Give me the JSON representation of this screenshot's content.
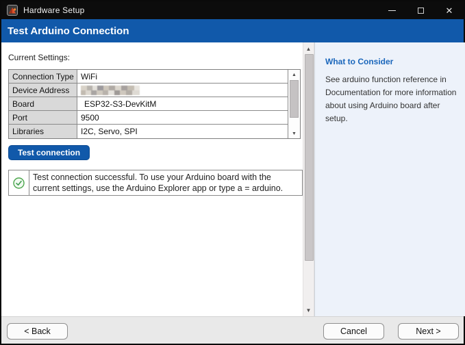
{
  "window": {
    "title": "Hardware Setup",
    "icons": {
      "app": "matlab-logo",
      "minimize": "minimize-line",
      "maximize": "maximize-square",
      "close": "✕"
    }
  },
  "header": {
    "title": "Test Arduino Connection",
    "background_color": "#1159aa"
  },
  "main": {
    "current_settings_label": "Current Settings:",
    "settings_table": {
      "rows": [
        {
          "label": "Connection Type",
          "value": "WiFi",
          "redacted": false
        },
        {
          "label": "Device Address",
          "value": "",
          "redacted": true
        },
        {
          "label": "Board",
          "value": "ESP32-S3-DevKitM",
          "redacted": false
        },
        {
          "label": "Port",
          "value": "9500",
          "redacted": false
        },
        {
          "label": "Libraries",
          "value": "I2C, Servo, SPI",
          "redacted": false
        }
      ],
      "scrollbar": {
        "up_icon": "▲",
        "down_icon": "▼"
      }
    },
    "test_connection_button_label": "Test connection",
    "status": {
      "icon": "success-check",
      "icon_color": "#3e9b4f",
      "message": "Test connection successful. To use your Arduino board with the current settings, use the Arduino Explorer app or type a = arduino."
    },
    "scrollbar": {
      "up_icon": "▲",
      "down_icon": "▼"
    }
  },
  "sidebar": {
    "heading": "What to Consider",
    "heading_color": "#1a66bb",
    "body": "See arduino function reference in Documentation for more information about using Arduino board after setup."
  },
  "footer": {
    "back_label": "< Back",
    "cancel_label": "Cancel",
    "next_label": "Next >"
  }
}
